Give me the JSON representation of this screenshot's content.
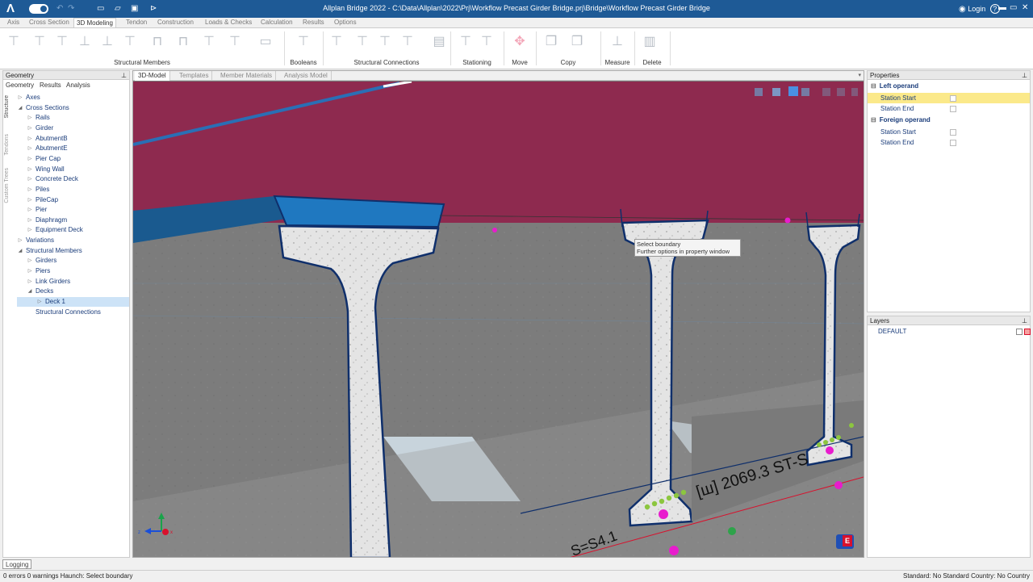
{
  "titlebar": {
    "title": "Allplan Bridge 2022 - C:\\Data\\Allplan\\2022\\Prj\\Workflow Precast Girder Bridge.prj\\Bridge\\Workflow Precast Girder Bridge",
    "login": "Login",
    "logo": "Λ",
    "help": "?",
    "minimize": "▬",
    "restore": "▭",
    "close": "✕"
  },
  "menu": [
    "Axis",
    "Cross Section",
    "3D Modeling",
    "Tendon",
    "Construction",
    "Loads & Checks",
    "Calculation",
    "Results",
    "Options"
  ],
  "ribbon": {
    "groups": [
      "Structural Members",
      "Booleans",
      "Structural Connections",
      "Stationing",
      "Move",
      "Copy",
      "Measure",
      "Delete"
    ]
  },
  "left_panel": {
    "title": "Geometry",
    "pin": "⊥",
    "tabs": [
      "Geometry",
      "Results",
      "Analysis"
    ],
    "vtabs": [
      "Structure",
      "Tendons",
      "Custom Trees"
    ],
    "tree": [
      {
        "label": "Axes",
        "arrow": "▷"
      },
      {
        "label": "Cross Sections",
        "arrow": "◢"
      },
      {
        "label": "Rails",
        "arrow": "▷"
      },
      {
        "label": "Girder",
        "arrow": "▷"
      },
      {
        "label": "AbutmentB",
        "arrow": "▷"
      },
      {
        "label": "AbutmentE",
        "arrow": "▷"
      },
      {
        "label": "Pier Cap",
        "arrow": "▷"
      },
      {
        "label": "Wing Wall",
        "arrow": "▷"
      },
      {
        "label": "Concrete Deck",
        "arrow": "▷"
      },
      {
        "label": "Piles",
        "arrow": "▷"
      },
      {
        "label": "PileCap",
        "arrow": "▷"
      },
      {
        "label": "Pier",
        "arrow": "▷"
      },
      {
        "label": "Diaphragm",
        "arrow": "▷"
      },
      {
        "label": "Equipment Deck",
        "arrow": "▷"
      },
      {
        "label": "Variations",
        "arrow": "▷"
      },
      {
        "label": "Structural Members",
        "arrow": "◢"
      },
      {
        "label": "Girders",
        "arrow": "▷"
      },
      {
        "label": "Piers",
        "arrow": "▷"
      },
      {
        "label": "Link Girders",
        "arrow": "▷"
      },
      {
        "label": "Decks",
        "arrow": "◢"
      },
      {
        "label": "Deck 1",
        "arrow": "▷"
      },
      {
        "label": "Structural Connections",
        "arrow": ""
      }
    ]
  },
  "viewport": {
    "tabs": [
      "3D-Model",
      "Templates",
      "Member Materials",
      "Analysis Model"
    ],
    "tooltip_line1": "Select boundary",
    "tooltip_line2": "Further options in property window",
    "station_text": "[ш] 2069.3 ST-S",
    "station_text2": "S=S4.1",
    "badge": "E"
  },
  "properties": {
    "title": "Properties",
    "pin": "⊥",
    "sections": [
      {
        "title": "Left operand",
        "rows": [
          "Station Start",
          "Station End"
        ]
      },
      {
        "title": "Foreign operand",
        "rows": [
          "Station Start",
          "Station End"
        ]
      }
    ]
  },
  "layers": {
    "title": "Layers",
    "pin": "⊥",
    "items": [
      "DEFAULT"
    ]
  },
  "logging": {
    "tab": "Logging"
  },
  "status": {
    "left": "0 errors 0 warnings   Haunch: Select boundary",
    "right": "Standard: No Standard Country: No Country"
  },
  "colors": {
    "titlebar": "#1e5a96",
    "sky": "#8e2a4f",
    "deck_blue": "#1f78c0",
    "girder": "#e6e6e6",
    "concrete": "#7a7a7a",
    "magenta": "#e81ccd",
    "green": "#8cc63f"
  }
}
